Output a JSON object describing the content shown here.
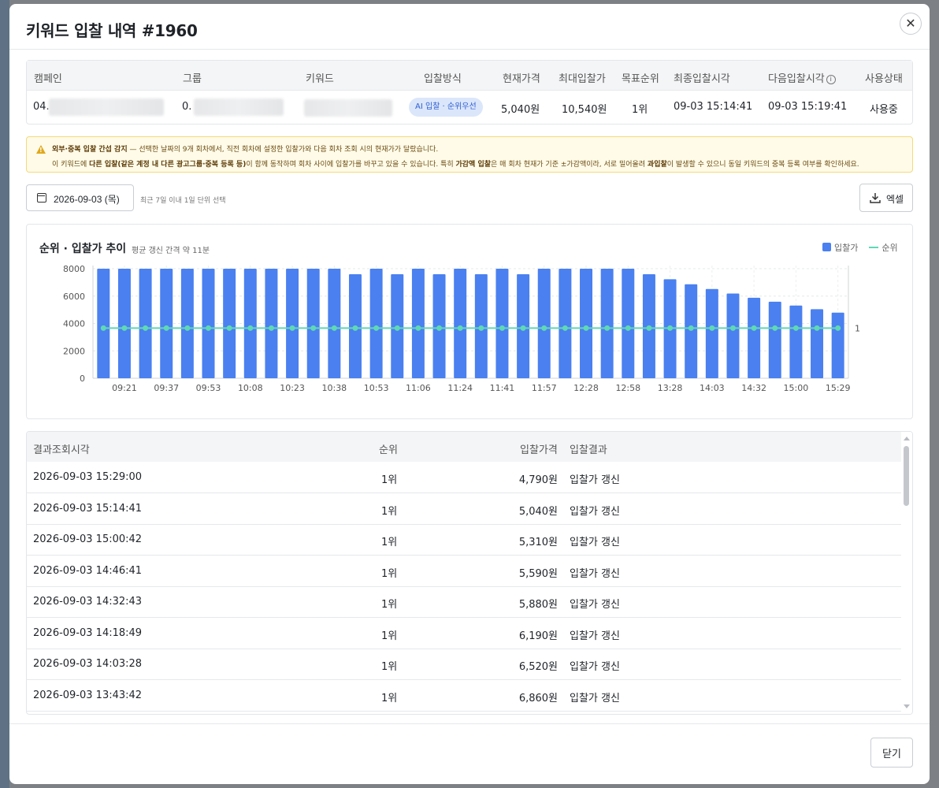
{
  "modal": {
    "title": "키워드 입찰 내역 #1960",
    "close_icon": "close-icon"
  },
  "summary": {
    "headers": {
      "campaign": "캠페인",
      "group": "그룹",
      "keyword": "키워드",
      "bid_method": "입찰방식",
      "current_price": "현재가격",
      "max_bid": "최대입찰가",
      "target_rank": "목표순위",
      "last_bid_time": "최종입찰시각",
      "next_bid_time": "다음입찰시각",
      "status": "사용상태"
    },
    "row": {
      "campaign": "04.",
      "group": "0.",
      "bid_method": "AI 입찰 · 순위우선",
      "current_price": "5,040원",
      "max_bid": "10,540원",
      "target_rank": "1위",
      "last_bid_time": "09-03 15:14:41",
      "next_bid_time": "09-03 15:19:41",
      "status": "사용중"
    }
  },
  "warning": {
    "icon": "warning-icon",
    "title": "외부·중복 입찰 간섭 감지",
    "line1_rest": " — 선택한 날짜의 9개 회차에서, 직전 회차에 설정한 입찰가와 다음 회차 조회 시의 현재가가 달랐습니다.",
    "line2_a": "이 키워드에 ",
    "line2_b": "다른 입찰(같은 계정 내 다른 광고그룹·중복 등록 등)",
    "line2_c": "이 함께 동작하며 회차 사이에 입찰가를 바꾸고 있을 수 있습니다. 특히 ",
    "line2_d": "가감액 입찰",
    "line2_e": "은 매 회차 현재가 기준 ±가감액이라, 서로 밀어올려 ",
    "line2_f": "과입찰",
    "line2_g": "이 발생할 수 있으니 동일 키워드의 중복 등록 여부를 확인하세요."
  },
  "controls": {
    "date": "2026-09-03 (목)",
    "date_hint": "최근 7일 이내 1일 단위 선택",
    "excel_label": "엑셀"
  },
  "chart": {
    "title": "순위 · 입찰가 추이",
    "subtitle": "평균 갱신 간격 약 11분",
    "legend_bar": "입찰가",
    "legend_line": "순위"
  },
  "chart_data": {
    "type": "bar",
    "y_ticks": [
      "0",
      "2000",
      "4000",
      "6000",
      "8000"
    ],
    "ylim": [
      0,
      8000
    ],
    "rank_tick": "1",
    "x_tick_labels": [
      "09:21",
      "09:37",
      "09:53",
      "10:08",
      "10:23",
      "10:38",
      "10:53",
      "11:06",
      "11:24",
      "11:41",
      "11:57",
      "12:28",
      "12:58",
      "13:28",
      "14:03",
      "14:32",
      "15:00",
      "15:29"
    ],
    "series": [
      {
        "name": "입찰가",
        "values": [
          8000,
          8000,
          8000,
          8000,
          8000,
          8000,
          8000,
          8000,
          8000,
          8000,
          8000,
          8000,
          7600,
          8000,
          7600,
          8000,
          7600,
          8000,
          7600,
          8000,
          7600,
          8000,
          8000,
          8000,
          8000,
          8000,
          7600,
          7230,
          6860,
          6520,
          6190,
          5880,
          5590,
          5310,
          5040,
          4790
        ]
      },
      {
        "name": "순위",
        "values": [
          1,
          1,
          1,
          1,
          1,
          1,
          1,
          1,
          1,
          1,
          1,
          1,
          1,
          1,
          1,
          1,
          1,
          1,
          1,
          1,
          1,
          1,
          1,
          1,
          1,
          1,
          1,
          1,
          1,
          1,
          1,
          1,
          1,
          1,
          1,
          1
        ]
      }
    ],
    "grid": true,
    "legend": "top-right"
  },
  "history": {
    "headers": {
      "time": "결과조회시각",
      "rank": "순위",
      "price": "입찰가격",
      "result": "입찰결과"
    },
    "rows": [
      {
        "time": "2026-09-03 15:29:00",
        "rank": "1위",
        "price": "4,790원",
        "result": "입찰가 갱신"
      },
      {
        "time": "2026-09-03 15:14:41",
        "rank": "1위",
        "price": "5,040원",
        "result": "입찰가 갱신"
      },
      {
        "time": "2026-09-03 15:00:42",
        "rank": "1위",
        "price": "5,310원",
        "result": "입찰가 갱신"
      },
      {
        "time": "2026-09-03 14:46:41",
        "rank": "1위",
        "price": "5,590원",
        "result": "입찰가 갱신"
      },
      {
        "time": "2026-09-03 14:32:43",
        "rank": "1위",
        "price": "5,880원",
        "result": "입찰가 갱신"
      },
      {
        "time": "2026-09-03 14:18:49",
        "rank": "1위",
        "price": "6,190원",
        "result": "입찰가 갱신"
      },
      {
        "time": "2026-09-03 14:03:28",
        "rank": "1위",
        "price": "6,520원",
        "result": "입찰가 갱신"
      },
      {
        "time": "2026-09-03 13:43:42",
        "rank": "1위",
        "price": "6,860원",
        "result": "입찰가 갱신"
      }
    ]
  },
  "footer": {
    "close_label": "닫기"
  },
  "colors": {
    "bar": "#4a80f0",
    "rank_line": "#5fd8b4",
    "badge_bg": "#dbe6fb",
    "warning_bg": "#fffbe8"
  }
}
